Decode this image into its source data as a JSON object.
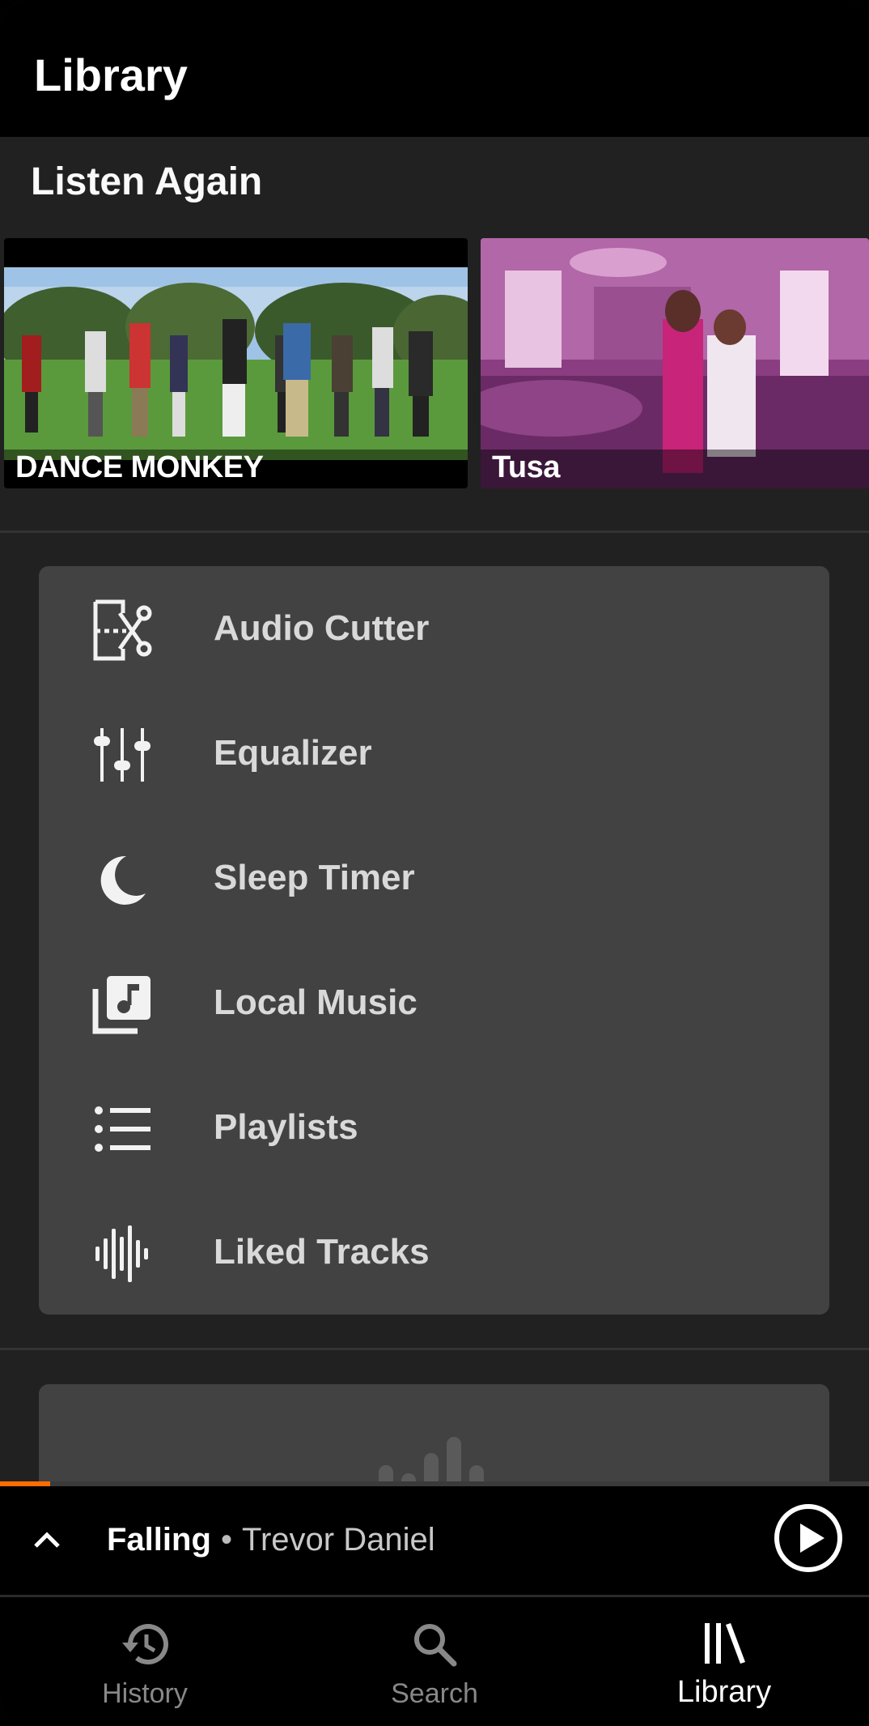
{
  "app_bar": {
    "title": "Library"
  },
  "listen_again": {
    "title": "Listen Again",
    "items": [
      {
        "label": "DANCE MONKEY"
      },
      {
        "label": "Tusa"
      }
    ]
  },
  "menu": {
    "items": [
      {
        "label": "Audio Cutter",
        "icon": "audio-cutter-icon"
      },
      {
        "label": "Equalizer",
        "icon": "equalizer-icon"
      },
      {
        "label": "Sleep Timer",
        "icon": "moon-icon"
      },
      {
        "label": "Local Music",
        "icon": "local-music-icon"
      },
      {
        "label": "Playlists",
        "icon": "list-icon"
      },
      {
        "label": "Liked Tracks",
        "icon": "waveform-icon"
      }
    ]
  },
  "now_playing": {
    "title": "Falling",
    "separator": "•",
    "artist": "Trevor Daniel",
    "progress_fraction": 0.058,
    "colors": {
      "progress": "#ff6d00"
    }
  },
  "bottom_nav": {
    "items": [
      {
        "label": "History",
        "icon": "history-icon",
        "active": false
      },
      {
        "label": "Search",
        "icon": "search-icon",
        "active": false
      },
      {
        "label": "Library",
        "icon": "library-icon",
        "active": true
      }
    ]
  }
}
